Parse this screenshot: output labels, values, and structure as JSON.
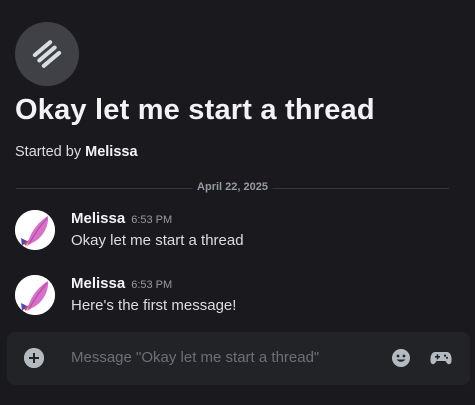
{
  "thread": {
    "icon": "threads-icon",
    "title": "Okay let me start a thread",
    "started_by_prefix": "Started by ",
    "started_by_author": "Melissa"
  },
  "date_divider": "April 22, 2025",
  "messages": [
    {
      "username": "Melissa",
      "timestamp": "6:53 PM",
      "content": "Okay let me start a thread",
      "avatar": "feather-avatar"
    },
    {
      "username": "Melissa",
      "timestamp": "6:53 PM",
      "content": "Here's the first message!",
      "avatar": "feather-avatar"
    }
  ],
  "composer": {
    "placeholder": "Message \"Okay let me start a thread\"",
    "icons": [
      "add-circle-icon",
      "emoji-icon",
      "gamepad-icon"
    ]
  },
  "colors": {
    "background": "#1a1a1e",
    "composer_bg": "#222327",
    "avatar_feather": "#d671c9"
  }
}
